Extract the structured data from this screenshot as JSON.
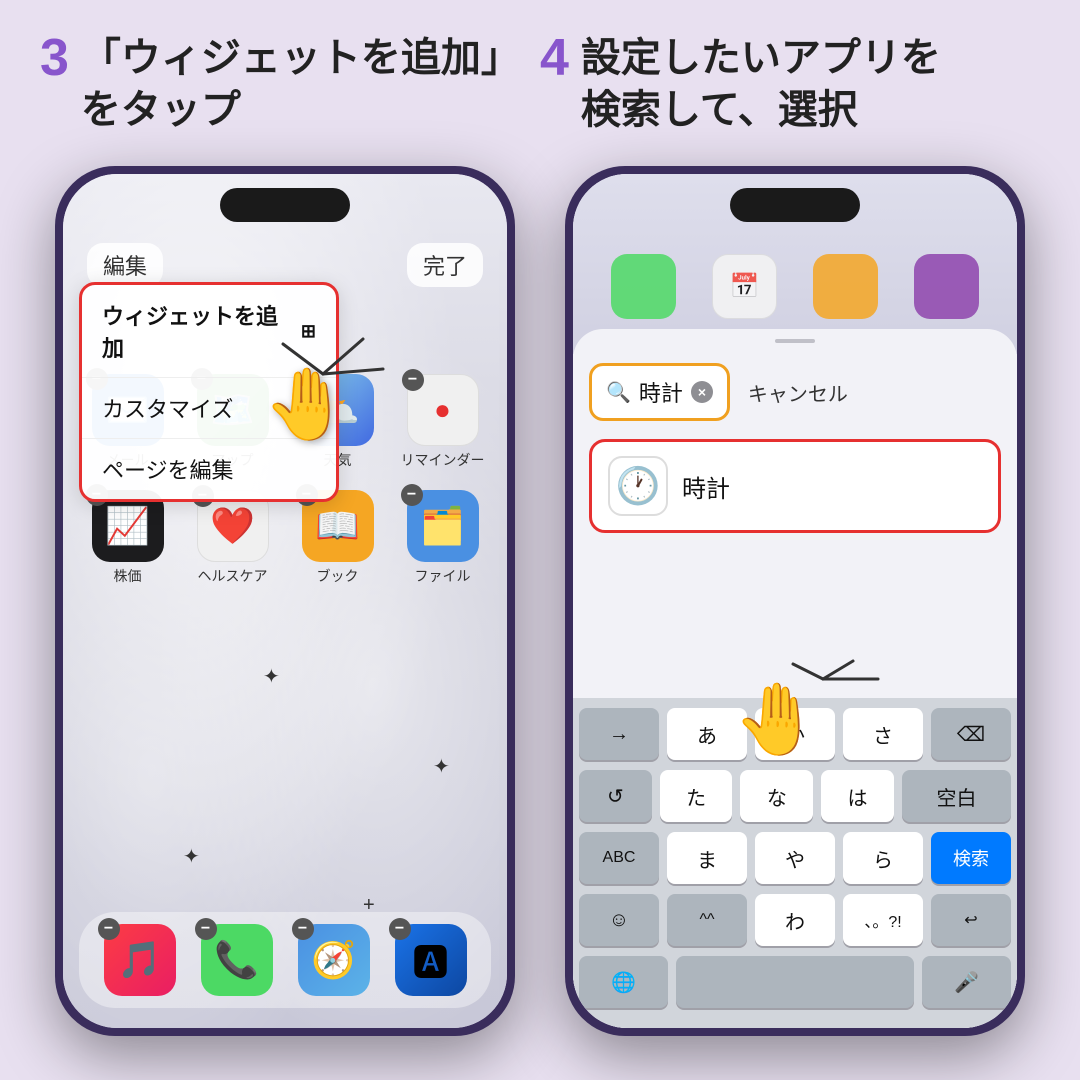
{
  "background_color": "#e8e0f0",
  "step3": {
    "number": "3",
    "title": "「ウィジェットを追加」\nをタップ"
  },
  "step4": {
    "number": "4",
    "title": "設定したいアプリを\n検索して、選択"
  },
  "phone1": {
    "top_left_btn": "編集",
    "top_right_btn": "完了",
    "menu_items": [
      "ウィジェットを追加",
      "カスタマイズ",
      "ページを編集"
    ],
    "apps_row1": [
      {
        "label": "メール",
        "emoji": "✉️",
        "color": "app-mail"
      },
      {
        "label": "マップ",
        "emoji": "🗺️",
        "color": "app-maps"
      },
      {
        "label": "天気",
        "emoji": "🌤️",
        "color": "app-weather"
      },
      {
        "label": "リマインダー",
        "emoji": "📋",
        "color": "app-reminders"
      }
    ],
    "apps_row2": [
      {
        "label": "株価",
        "emoji": "📈",
        "color": "app-stocks"
      },
      {
        "label": "ヘルスケア",
        "emoji": "❤️",
        "color": "app-health"
      },
      {
        "label": "ブック",
        "emoji": "📚",
        "color": "app-books"
      },
      {
        "label": "ファイル",
        "emoji": "🗂️",
        "color": "app-files"
      }
    ],
    "dock": [
      "🎵",
      "📞",
      "🧭",
      "🅰"
    ]
  },
  "phone2": {
    "search_placeholder": "時計",
    "cancel_label": "キャンセル",
    "search_result": "時計",
    "keyboard": {
      "row1": [
        "あ",
        "か",
        "さ",
        "⌫"
      ],
      "row2": [
        "た",
        "な",
        "は",
        "空白"
      ],
      "row3": [
        "ま",
        "や",
        "ら",
        "検索"
      ],
      "row4": [
        "わ",
        "、。?!",
        "↩"
      ],
      "special": [
        "→",
        "⏎",
        "ABC",
        "☺",
        "^^",
        "🌐",
        "🎤"
      ]
    }
  }
}
